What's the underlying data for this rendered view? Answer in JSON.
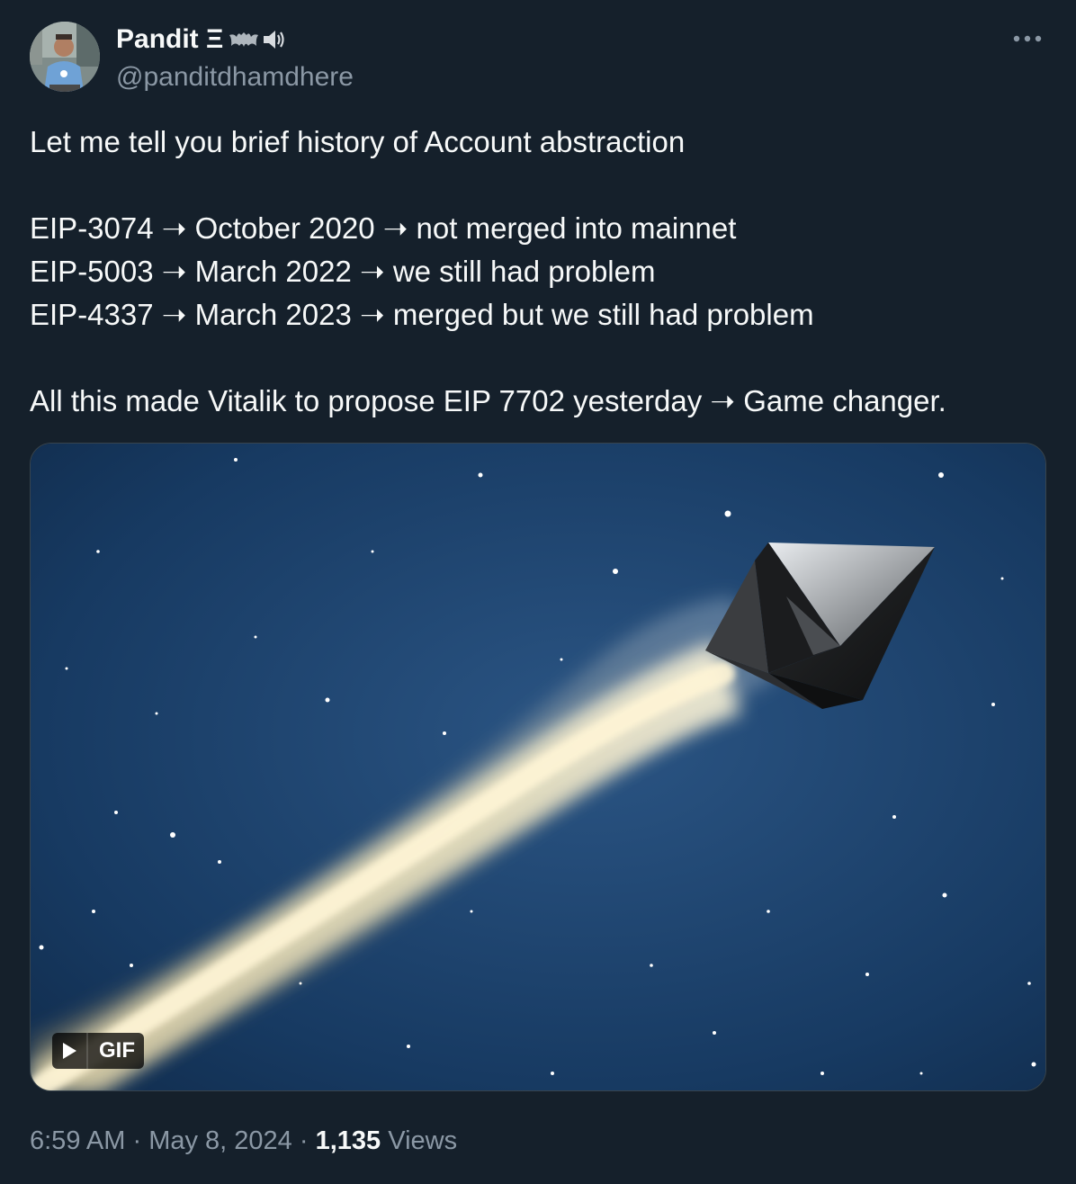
{
  "author": {
    "display_name": "Pandit Ξ",
    "handle": "@panditdhamdhere",
    "name_emoji_icons": [
      "bat-icon",
      "speaker-icon"
    ]
  },
  "tweet": {
    "lines": [
      "Let me tell you brief history of Account abstraction",
      "",
      "EIP-3074 ➝ October 2020 ➝ not merged into mainnet",
      "EIP-5003 ➝ March 2022 ➝ we still had problem",
      "EIP-4337 ➝ March 2023 ➝ merged but we still had problem",
      "",
      "All this made Vitalik to propose EIP 7702 yesterday ➝ Game changer."
    ]
  },
  "media": {
    "type": "gif",
    "badge_label": "GIF",
    "icons": [
      "play-icon"
    ]
  },
  "meta": {
    "time": "6:59 AM",
    "separator": "·",
    "date": "May 8, 2024",
    "views_count": "1,135",
    "views_label": "Views"
  },
  "colors": {
    "background": "#15202b",
    "text_primary": "#f7f9f9",
    "text_secondary": "#8b98a5",
    "border": "#38444d"
  }
}
